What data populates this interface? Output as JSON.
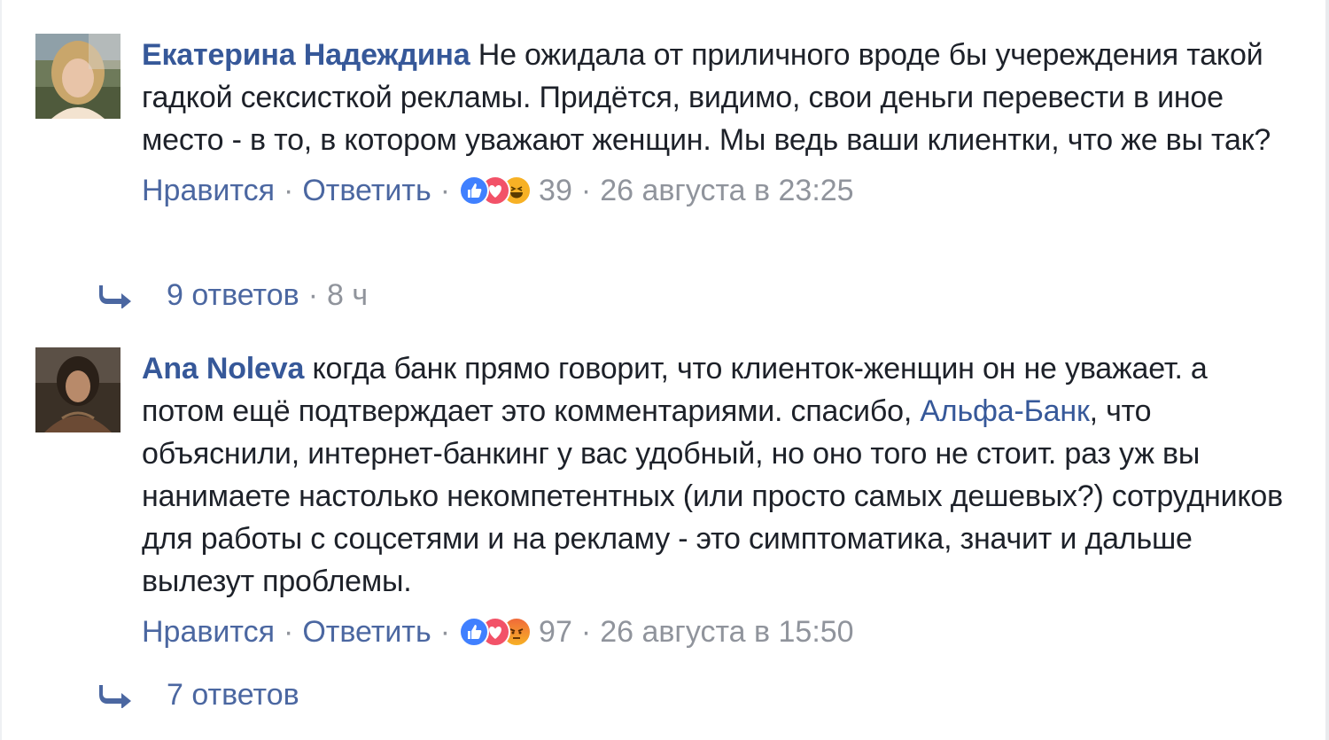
{
  "comments": [
    {
      "author": "Екатерина Надеждина",
      "text": "Не ожидала от приличного вроде бы учереждения такой гадкой сексисткой рекламы. Придётся, видимо, свои деньги перевести в иное место - в то, в котором уважают женщин. Мы ведь ваши клиентки, что же вы так?",
      "mention": "",
      "text_after": "",
      "like_label": "Нравится",
      "reply_label": "Ответить",
      "reactions": [
        "like-icon",
        "love-icon",
        "haha-icon"
      ],
      "reaction_count": "39",
      "timestamp": "26 августа в 23:25",
      "replies_label": "9 ответов",
      "replies_time": "8 ч"
    },
    {
      "author": "Ana Noleva",
      "text": "когда банк прямо говорит, что клиенток-женщин он не уважает. а потом ещё подтверждает это комментариями. спасибо, ",
      "mention": "Альфа-Банк",
      "text_after": ", что объяснили, интернет-банкинг у вас удобный, но оно того не стоит. раз уж вы нанимаете настолько некомпетентных (или просто самых дешевых?) сотрудников для работы с соцсетями и на рекламу - это симптоматика, значит и дальше вылезут проблемы.",
      "like_label": "Нравится",
      "reply_label": "Ответить",
      "reactions": [
        "like-icon",
        "love-icon",
        "angry-icon"
      ],
      "reaction_count": "97",
      "timestamp": "26 августа в 15:50",
      "replies_label": "7 ответов",
      "replies_time": ""
    }
  ],
  "separator": "·",
  "colors": {
    "link": "#365899",
    "action": "#4b67a1",
    "meta": "#90949c",
    "text": "#1d2129",
    "like": "#4080ff",
    "love": "#f25268",
    "haha": "#f7b125"
  }
}
